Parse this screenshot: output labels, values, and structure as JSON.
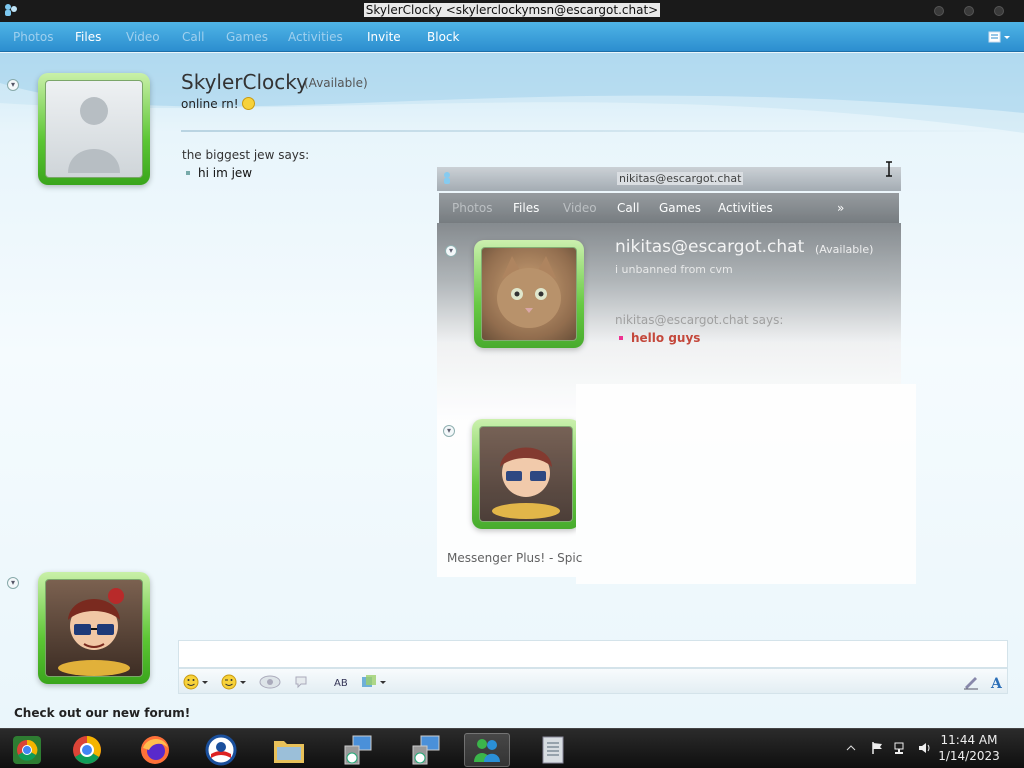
{
  "window": {
    "title": "SkylerClocky <skylerclockymsn@escargot.chat>"
  },
  "toolbar": {
    "items": [
      {
        "label": "Photos",
        "enabled": false
      },
      {
        "label": "Files",
        "enabled": true
      },
      {
        "label": "Video",
        "enabled": false
      },
      {
        "label": "Call",
        "enabled": false
      },
      {
        "label": "Games",
        "enabled": false
      },
      {
        "label": "Activities",
        "enabled": false
      },
      {
        "label": "Invite",
        "enabled": true
      },
      {
        "label": "Block",
        "enabled": true
      }
    ]
  },
  "contact": {
    "name": "SkylerClocky",
    "status": "(Available)",
    "psm": "online rn!"
  },
  "messages": [
    {
      "sender_line": "the biggest jew says:",
      "text": "hi im jew"
    }
  ],
  "ghost_window": {
    "title": "nikitas@escargot.chat",
    "toolbar": [
      {
        "label": "Photos",
        "enabled": false
      },
      {
        "label": "Files",
        "enabled": true
      },
      {
        "label": "Video",
        "enabled": false
      },
      {
        "label": "Call",
        "enabled": true
      },
      {
        "label": "Games",
        "enabled": true
      },
      {
        "label": "Activities",
        "enabled": true
      },
      {
        "label": "»",
        "enabled": true
      }
    ],
    "contact_name": "nikitas@escargot.chat",
    "contact_status": "(Available)",
    "psm": "i unbanned from cvm",
    "sender_line": "nikitas@escargot.chat says:",
    "message": "hello guys",
    "footer": "Messenger Plus! - Spic"
  },
  "footer": {
    "forum_link": "Check out our new forum!"
  },
  "taskbar": {
    "time": "11:44 AM",
    "date": "1/14/2023"
  },
  "colors": {
    "toolbar_blue": "#2c8ecf",
    "avatar_green": "#5cc634",
    "message_red": "#c0392b"
  }
}
